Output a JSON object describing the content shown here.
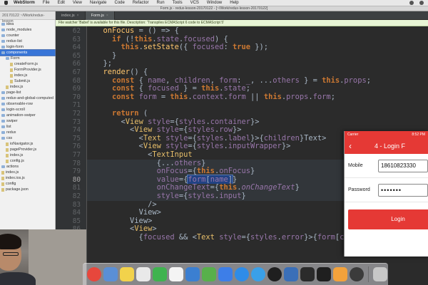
{
  "menubar": {
    "items": [
      "WebStorm",
      "File",
      "Edit",
      "View",
      "Navigate",
      "Code",
      "Refactor",
      "Run",
      "Tools",
      "VCS",
      "Window",
      "Help"
    ]
  },
  "window": {
    "title": "Form.js - redux-lesson-20170122 - [~/Work/redux-lesson-20170122]"
  },
  "sidebar": {
    "header": "20170122 ~/Work/redux-lesson",
    "items": [
      {
        "label": "idea",
        "kind": "folder",
        "selected": false
      },
      {
        "label": "node_modules",
        "kind": "folder",
        "selected": false
      },
      {
        "label": "counter",
        "kind": "folder",
        "selected": false
      },
      {
        "label": "redux-list",
        "kind": "folder",
        "selected": false
      },
      {
        "label": "login-form",
        "kind": "folder",
        "selected": false
      },
      {
        "label": "components",
        "kind": "folder",
        "selected": true
      },
      {
        "label": "Form",
        "kind": "folder",
        "selected": false
      },
      {
        "label": "createForm.js",
        "kind": "file",
        "selected": false
      },
      {
        "label": "FormProvider.js",
        "kind": "file",
        "selected": false
      },
      {
        "label": "index.js",
        "kind": "file",
        "selected": false
      },
      {
        "label": "Submit.js",
        "kind": "file",
        "selected": false
      },
      {
        "label": "index.js",
        "kind": "file",
        "selected": false
      },
      {
        "label": "page-list",
        "kind": "folder",
        "selected": false
      },
      {
        "label": "redux-and-global-computed",
        "kind": "folder",
        "selected": false
      },
      {
        "label": "observable-row",
        "kind": "folder",
        "selected": false
      },
      {
        "label": "login-scroll",
        "kind": "folder",
        "selected": false
      },
      {
        "label": "animation-swiper",
        "kind": "folder",
        "selected": false
      },
      {
        "label": "swiper",
        "kind": "folder",
        "selected": false
      },
      {
        "label": "list",
        "kind": "folder",
        "selected": false
      },
      {
        "label": "redux",
        "kind": "folder",
        "selected": false
      },
      {
        "label": "css",
        "kind": "folder",
        "selected": false
      },
      {
        "label": "ioNavigator.js",
        "kind": "file",
        "selected": false
      },
      {
        "label": "pageProvider.js",
        "kind": "file",
        "selected": false
      },
      {
        "label": "index.js",
        "kind": "file",
        "selected": false
      },
      {
        "label": "config.js",
        "kind": "file",
        "selected": false
      },
      {
        "label": "actions",
        "kind": "folder",
        "selected": false
      },
      {
        "label": "index.js",
        "kind": "file",
        "selected": false
      },
      {
        "label": "index.ios.js",
        "kind": "file",
        "selected": false
      },
      {
        "label": "config",
        "kind": "file",
        "selected": false
      },
      {
        "label": "package.json",
        "kind": "file",
        "selected": false
      }
    ]
  },
  "tabs": [
    {
      "label": "index.js",
      "active": false
    },
    {
      "label": "Form.js",
      "active": true
    }
  ],
  "notification": "File watcher 'Babel' is available for this file. Description: 'Transpiles ECMAScript 6 code to ECMAScript 5'",
  "editor": {
    "current_line": 80,
    "lines": [
      {
        "n": 62,
        "html": "  <span class=\"f\">onFocus</span> = () => {"
      },
      {
        "n": 63,
        "html": "    <span class=\"k\">if</span> (!<span class=\"k\">this</span>.<span class=\"p\">state</span>.<span class=\"p\">focused</span>) {"
      },
      {
        "n": 64,
        "html": "      <span class=\"k\">this</span>.<span class=\"f\">setState</span>({ <span class=\"p\">focused</span>: <span class=\"k\">true</span> });"
      },
      {
        "n": 65,
        "html": "    }"
      },
      {
        "n": 66,
        "html": "  };"
      },
      {
        "n": 67,
        "html": "  <span class=\"f\">render</span>() {"
      },
      {
        "n": 68,
        "html": "    <span class=\"k\">const</span> { <span class=\"p\">name</span>, <span class=\"p\">children</span>, <span class=\"p\">form</span>: <span class=\"it\">_</span>, ...<span class=\"p\">others</span> } = <span class=\"k\">this</span>.<span class=\"p\">props</span>;"
      },
      {
        "n": 69,
        "html": "    <span class=\"k\">const</span> { <span class=\"p\">focused</span> } = <span class=\"k\">this</span>.<span class=\"p\">state</span>;"
      },
      {
        "n": 70,
        "html": "    <span class=\"k\">const</span> <span class=\"p\">form</span> = <span class=\"k\">this</span>.<span class=\"p\">context</span>.<span class=\"p\">form</span> || <span class=\"k\">this</span>.<span class=\"p\">props</span>.<span class=\"p\">form</span>;"
      },
      {
        "n": 71,
        "html": ""
      },
      {
        "n": 72,
        "html": "    <span class=\"k\">return</span> ("
      },
      {
        "n": 73,
        "html": "      <<span class=\"t\">View</span> <span class=\"p\">style</span>={<span class=\"p\">styles</span>.<span class=\"p\">container</span>}>"
      },
      {
        "n": 74,
        "html": "        <<span class=\"t\">View</span> <span class=\"p\">style</span>={<span class=\"p\">styles</span>.<span class=\"p\">row</span>}>"
      },
      {
        "n": 75,
        "html": "          <<span class=\"t\">Text</span> <span class=\"p\">style</span>={<span class=\"p\">styles</span>.<span class=\"p\">label</span>}>{<span class=\"p\">children</span>}</<span class=\"t\">Text</span>>"
      },
      {
        "n": 76,
        "html": "          <<span class=\"t\">View</span> <span class=\"p\">style</span>={<span class=\"p\">styles</span>.<span class=\"p\">inputWrapper</span>}>"
      },
      {
        "n": 77,
        "html": "            <<span class=\"t\">TextInput</span>"
      },
      {
        "n": 78,
        "html": "              {...<span class=\"p\">others</span>}"
      },
      {
        "n": 79,
        "html": "              <span class=\"p\">onFocus</span>={<span class=\"k\">this</span>.<span class=\"p\">onFocus</span>}"
      },
      {
        "n": 80,
        "html": "              <span class=\"p\">value</span>={<span class=\"sel\"><span class=\"p\">form</span>[<span class=\"p\">name</span>]</span>}"
      },
      {
        "n": 81,
        "html": "              <span class=\"p\">onChangeText</span>={<span class=\"k\">this</span>.<span class=\"it\">onChangeText</span>}"
      },
      {
        "n": 82,
        "html": "              <span class=\"p\">style</span>={<span class=\"p\">styles</span>.<span class=\"p\">input</span>}"
      },
      {
        "n": 83,
        "html": "            />"
      },
      {
        "n": 84,
        "html": "          </<span class=\"t\">View</span>>"
      },
      {
        "n": 85,
        "html": "        </<span class=\"t\">View</span>>"
      },
      {
        "n": 86,
        "html": "        <<span class=\"t\">View</span>>"
      },
      {
        "n": 87,
        "html": "          {<span class=\"p\">focused</span> && <<span class=\"t\">Text</span> <span class=\"p\">style</span>={<span class=\"p\">styles</span>.<span class=\"p\">error</span>}>{<span class=\"p\">form</span>[<span class=\"p\">camelC</span>"
      }
    ],
    "highlighted_lines": [
      78,
      79,
      80,
      81,
      82
    ]
  },
  "phone": {
    "status_left": "Carrier",
    "status_time": "8:52 PM",
    "back_glyph": "‹",
    "title": "4 - Login F",
    "mobile_label": "Mobile",
    "mobile_value": "18610823330",
    "password_label": "Password",
    "password_value": "•••••••",
    "login_label": "Login",
    "accent": "#e53935"
  },
  "dock": {
    "apps": [
      {
        "name": "chrome",
        "color": "#e7473c"
      },
      {
        "name": "folder",
        "color": "#5a8fd6"
      },
      {
        "name": "notes",
        "color": "#f2d24b"
      },
      {
        "name": "preview",
        "color": "#e9e9e9"
      },
      {
        "name": "wechat",
        "color": "#3fb34f"
      },
      {
        "name": "calendar",
        "color": "#f4f4f4"
      },
      {
        "name": "finder-2",
        "color": "#3b7fd1"
      },
      {
        "name": "numbers",
        "color": "#58b04b"
      },
      {
        "name": "keynote",
        "color": "#3d7ee8"
      },
      {
        "name": "app-store",
        "color": "#2e8ce8"
      },
      {
        "name": "safari",
        "color": "#3aa0e8"
      },
      {
        "name": "qq",
        "color": "#1f1f1f"
      },
      {
        "name": "xcode",
        "color": "#3a6fb8"
      },
      {
        "name": "terminal",
        "color": "#2b2b2b"
      },
      {
        "name": "webstorm",
        "color": "#1f1f1f"
      },
      {
        "name": "photos",
        "color": "#f3a23b"
      },
      {
        "name": "quicktime",
        "color": "#3b3b3b"
      },
      {
        "name": "trash",
        "color": "#c7c7c7"
      }
    ]
  }
}
